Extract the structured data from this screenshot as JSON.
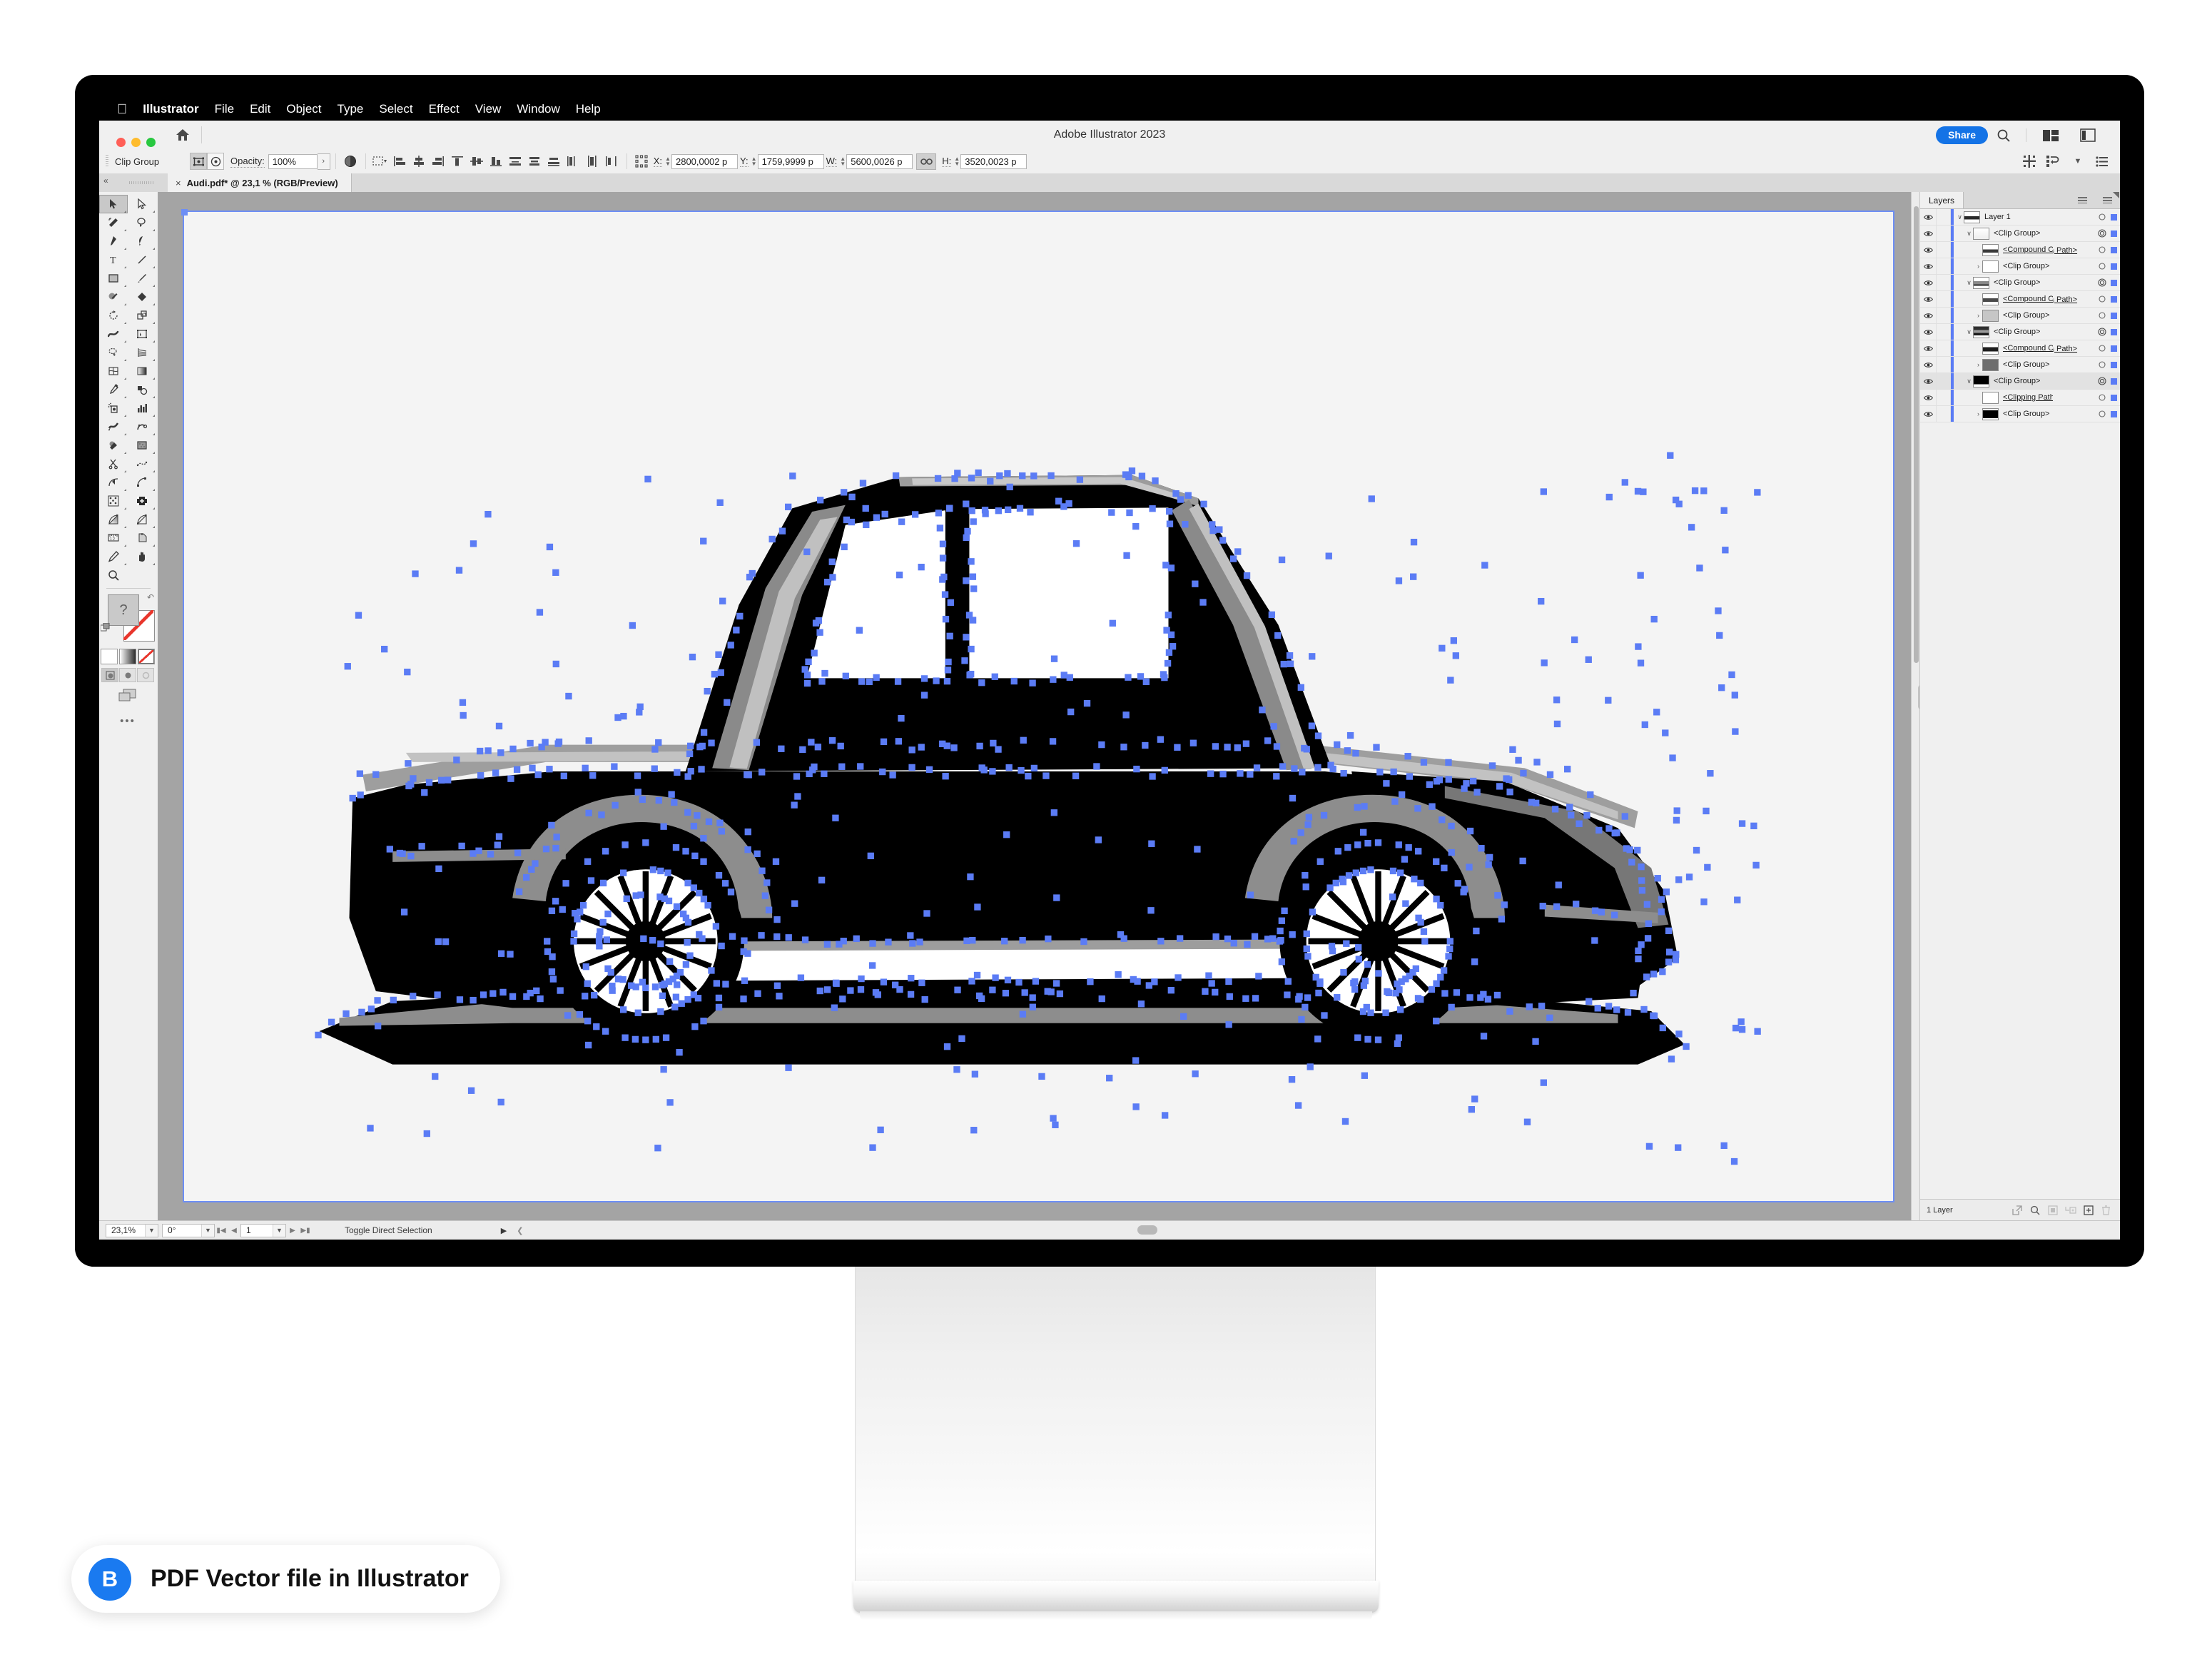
{
  "caption": {
    "badge_letter": "B",
    "text": "PDF Vector file in Illustrator",
    "badge_color": "#1a7af0"
  },
  "menubar": {
    "apple": "",
    "items": [
      "Illustrator",
      "File",
      "Edit",
      "Object",
      "Type",
      "Select",
      "Effect",
      "View",
      "Window",
      "Help"
    ]
  },
  "titlebar": {
    "app_title": "Adobe Illustrator 2023",
    "share_label": "Share",
    "share_color": "#1473e6"
  },
  "controlbar": {
    "object_name": "Clip Group",
    "opacity_label": "Opacity:",
    "opacity_value": "100%",
    "opacity_arrow": "›",
    "coords": [
      {
        "label": "X:",
        "value": "2800,0002 p"
      },
      {
        "label": "Y:",
        "value": "1759,9999 p"
      },
      {
        "label": "W:",
        "value": "5600,0026 p"
      },
      {
        "label": "H:",
        "value": "3520,0023 p"
      }
    ],
    "align_icons": [
      "align-options-icon",
      "align-left-icon",
      "align-center-h-icon",
      "align-right-icon",
      "align-top-icon",
      "align-middle-v-icon",
      "align-bottom-icon",
      "distribute-top-icon",
      "distribute-center-v-icon",
      "distribute-bottom-icon",
      "distribute-left-icon",
      "distribute-center-h-icon",
      "distribute-right-icon",
      "transform-icon"
    ]
  },
  "document_tab": {
    "close": "×",
    "name": "Audi.pdf* @ 23,1 % (RGB/Preview)"
  },
  "statusbar": {
    "zoom": "23,1%",
    "rotation": "0°",
    "artboard": "1",
    "mode": "Toggle Direct Selection",
    "caret": "▶"
  },
  "layers": {
    "panel_title": "Layers",
    "footer_count": "1 Layer",
    "footer_icons": [
      "locate-object-icon",
      "search-icon",
      "make-clipping-mask-icon",
      "create-new-sublayer-icon",
      "create-new-layer-icon",
      "delete-selection-icon"
    ],
    "rows": [
      {
        "name": "Layer 1",
        "sub": "",
        "indent": 0,
        "chevron": "down",
        "thumb": "car-full",
        "target": "circle",
        "selected": false,
        "underline": false
      },
      {
        "name": "<Clip Group>",
        "sub": "",
        "indent": 1,
        "chevron": "down",
        "thumb": "light",
        "target": "double",
        "selected": false,
        "underline": false
      },
      {
        "name": "<Compound Clipping Path>",
        "sub": "ⱼ Path>",
        "indent": 2,
        "chevron": "none",
        "thumb": "car-light",
        "target": "circle",
        "selected": false,
        "underline": true
      },
      {
        "name": "<Clip Group>",
        "sub": "",
        "indent": 2,
        "chevron": "right",
        "thumb": "white",
        "target": "circle",
        "selected": false,
        "underline": false
      },
      {
        "name": "<Clip Group>",
        "sub": "",
        "indent": 1,
        "chevron": "down",
        "thumb": "car-mid",
        "target": "double",
        "selected": false,
        "underline": false
      },
      {
        "name": "<Compound Clipping Path>",
        "sub": "ⱼ Path>",
        "indent": 2,
        "chevron": "none",
        "thumb": "car-mid2",
        "target": "circle",
        "selected": false,
        "underline": true
      },
      {
        "name": "<Clip Group>",
        "sub": "",
        "indent": 2,
        "chevron": "right",
        "thumb": "grey",
        "target": "circle",
        "selected": false,
        "underline": false
      },
      {
        "name": "<Clip Group>",
        "sub": "",
        "indent": 1,
        "chevron": "down",
        "thumb": "car-dark",
        "target": "double",
        "selected": false,
        "underline": false
      },
      {
        "name": "<Compound Clipping Path>",
        "sub": "ⱼ Path>",
        "indent": 2,
        "chevron": "none",
        "thumb": "car-dk2",
        "target": "circle",
        "selected": false,
        "underline": true
      },
      {
        "name": "<Clip Group>",
        "sub": "",
        "indent": 2,
        "chevron": "right",
        "thumb": "darkgrey",
        "target": "circle",
        "selected": false,
        "underline": false
      },
      {
        "name": "<Clip Group>",
        "sub": "",
        "indent": 1,
        "chevron": "down",
        "thumb": "black",
        "target": "double",
        "selected": true,
        "underline": false
      },
      {
        "name": "<Clipping Path>",
        "sub": "",
        "indent": 2,
        "chevron": "none",
        "thumb": "white",
        "target": "circle",
        "selected": false,
        "underline": true
      },
      {
        "name": "<Clip Group>",
        "sub": "",
        "indent": 2,
        "chevron": "right",
        "thumb": "black2",
        "target": "circle",
        "selected": false,
        "underline": false
      }
    ]
  },
  "toolbar": {
    "collapse": "«",
    "more": "•••",
    "fill_glyph": "?",
    "tools": [
      "selection-tool",
      "direct-selection-tool",
      "magic-wand-tool",
      "lasso-tool",
      "pen-tool",
      "curvature-tool",
      "type-tool",
      "line-segment-tool",
      "rectangle-tool",
      "paintbrush-tool",
      "shaper-tool",
      "eraser-tool",
      "rotate-tool",
      "scale-tool",
      "width-tool",
      "free-transform-tool",
      "shape-builder-tool",
      "perspective-grid-tool",
      "mesh-tool",
      "gradient-tool",
      "eyedropper-tool",
      "blend-tool",
      "symbol-sprayer-tool",
      "column-graph-tool",
      "slice-tool",
      "puppet-warp-tool",
      "artboard-tool",
      "slice-select-tool",
      "scissors-tool",
      "smooth-tool",
      "join-tool",
      "measure-tool",
      "add-anchor-point-tool",
      "delete-anchor-point-tool",
      "rotate-view-tool",
      "zoom-tool2",
      "pencil-tool-b",
      "knife-tool",
      "reflect-tool",
      "shear-tool",
      "ruler-tool",
      "crop-image-tool",
      "pencil-tool",
      "hand-tool",
      "zoom-tool"
    ]
  },
  "canvas": {
    "artwork_name": "audi-car-vector-artwork",
    "anchor_color": "#5b7cf5",
    "artwork_dark": "#000000",
    "artwork_mid": "#7a7a7a",
    "artwork_light": "#c2c2c2",
    "artboard_bg": "#f4f4f4",
    "canvas_bg": "#a4a4a4"
  }
}
